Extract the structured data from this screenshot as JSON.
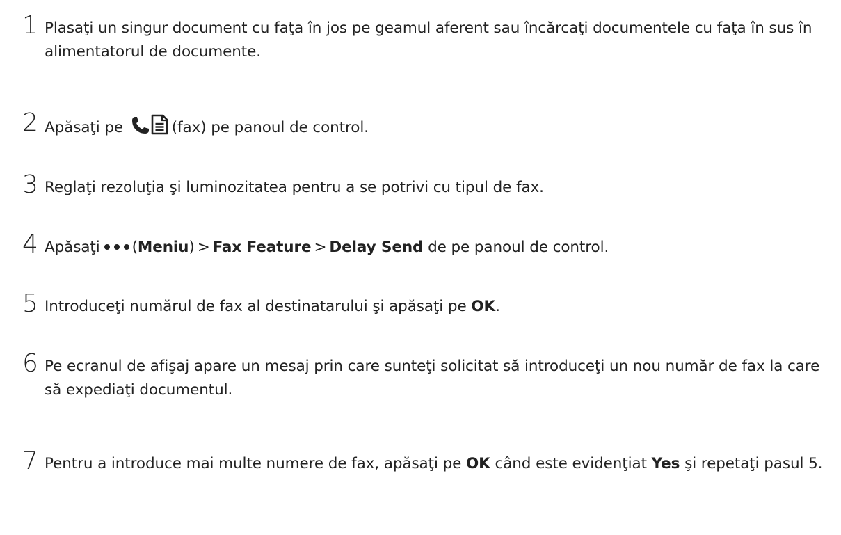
{
  "steps": [
    {
      "number": "1",
      "text": "Plasaţi un singur document cu faţa în jos pe geamul aferent sau încărcaţi documentele cu faţa în sus în alimentatorul de documente."
    },
    {
      "number": "2",
      "before": "Apăsaţi pe",
      "icon": "fax-icon",
      "after": "(fax) pe panoul de control."
    },
    {
      "number": "3",
      "text": "Reglaţi rezoluţia şi luminozitatea pentru a se potrivi cu tipul de fax."
    },
    {
      "number": "4",
      "before": "Apăsaţi",
      "icon": "more-dots-icon",
      "paren_open": "(",
      "menu": "Meniu",
      "paren_close": ")",
      "sep1": ">",
      "item1": "Fax Feature",
      "sep2": ">",
      "item2": "Delay Send",
      "after": "de pe panoul de control."
    },
    {
      "number": "5",
      "before": "Introduceţi numărul de fax al destinatarului şi apăsaţi pe",
      "ok": "OK",
      "after": "."
    },
    {
      "number": "6",
      "text": "Pe ecranul de afişaj apare un mesaj prin care sunteţi solicitat să introduceţi un nou număr de fax la care să expediaţi documentul."
    },
    {
      "number": "7",
      "before": "Pentru a introduce mai multe numere de fax, apăsaţi pe",
      "ok": "OK",
      "middle": "când este evidenţiat",
      "yes": "Yes",
      "after": "şi repetaţi pasul 5."
    }
  ]
}
